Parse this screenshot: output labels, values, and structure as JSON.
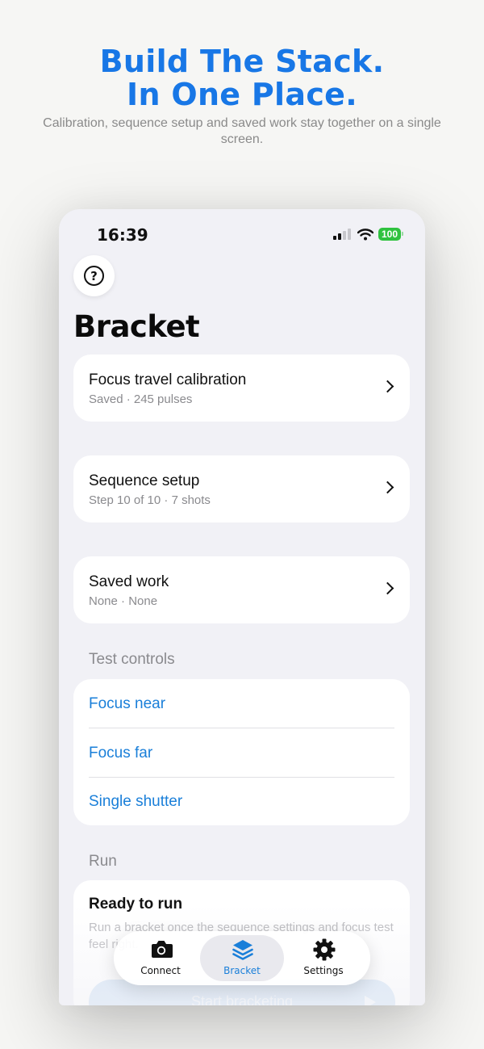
{
  "hero": {
    "title_line1": "Build The Stack.",
    "title_line2": "In One Place.",
    "subtitle": "Calibration, sequence setup and saved work stay together on a single screen."
  },
  "status_bar": {
    "time": "16:39",
    "battery": "100",
    "battery_color": "#2fc23f"
  },
  "screen": {
    "title": "Bracket",
    "help_label": "?",
    "cards": [
      {
        "title": "Focus travel calibration",
        "subtitle": "Saved · 245 pulses"
      },
      {
        "title": "Sequence setup",
        "subtitle": "Step 10 of 10 · 7 shots"
      },
      {
        "title": "Saved work",
        "subtitle": "None · None"
      }
    ],
    "test_controls": {
      "header": "Test controls",
      "items": [
        "Focus near",
        "Focus far",
        "Single shutter"
      ]
    },
    "run": {
      "header": "Run",
      "title": "Ready to run",
      "description": "Run a bracket once the sequence settings and focus test feel right.",
      "start_label": "Start bracketing"
    }
  },
  "tab_bar": {
    "tabs": [
      {
        "label": "Connect",
        "icon": "camera-icon"
      },
      {
        "label": "Bracket",
        "icon": "stack-icon",
        "selected": true
      },
      {
        "label": "Settings",
        "icon": "gear-icon"
      }
    ]
  },
  "colors": {
    "accent": "#1a7fd9",
    "hero_title": "#1877e6",
    "background": "#f1f1f6"
  }
}
